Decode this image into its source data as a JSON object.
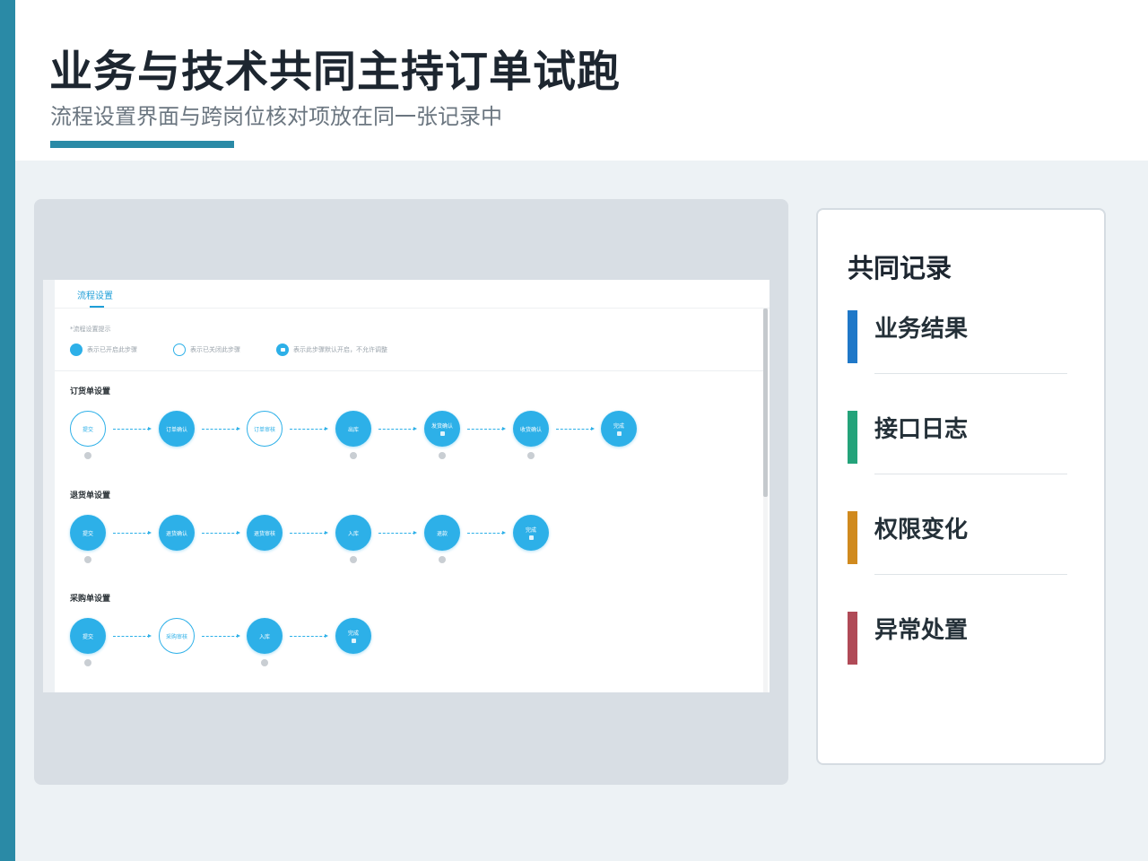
{
  "header": {
    "title": "业务与技术共同主持订单试跑",
    "subtitle": "流程设置界面与跨岗位核对项放在同一张记录中"
  },
  "screenshot": {
    "tab": "流程设置",
    "hint_title": "*流程设置提示",
    "legend": [
      "表示已开启此步骤",
      "表示已关闭此步骤",
      "表示此步骤默认开启，不允许调整"
    ],
    "sections": [
      {
        "title": "订货单设置",
        "steps": [
          {
            "label": "提交",
            "state": "off",
            "lock": false,
            "q": true
          },
          {
            "label": "订单确认",
            "state": "on",
            "lock": false,
            "q": false
          },
          {
            "label": "订单审核",
            "state": "off",
            "lock": false,
            "q": false
          },
          {
            "label": "出库",
            "state": "on",
            "lock": false,
            "q": true
          },
          {
            "label": "发货确认",
            "state": "on",
            "lock": true,
            "q": true
          },
          {
            "label": "收货确认",
            "state": "on",
            "lock": false,
            "q": true
          },
          {
            "label": "完成",
            "state": "on",
            "lock": true,
            "q": false
          }
        ]
      },
      {
        "title": "退货单设置",
        "steps": [
          {
            "label": "提交",
            "state": "on",
            "lock": false,
            "q": true
          },
          {
            "label": "退货确认",
            "state": "on",
            "lock": false,
            "q": false
          },
          {
            "label": "退货审核",
            "state": "on",
            "lock": false,
            "q": false
          },
          {
            "label": "入库",
            "state": "on",
            "lock": false,
            "q": true
          },
          {
            "label": "退款",
            "state": "on",
            "lock": false,
            "q": true
          },
          {
            "label": "完成",
            "state": "on",
            "lock": true,
            "q": false
          }
        ]
      },
      {
        "title": "采购单设置",
        "steps": [
          {
            "label": "提交",
            "state": "on",
            "lock": false,
            "q": true
          },
          {
            "label": "采购审核",
            "state": "off",
            "lock": false,
            "q": false
          },
          {
            "label": "入库",
            "state": "on",
            "lock": false,
            "q": true
          },
          {
            "label": "完成",
            "state": "on",
            "lock": true,
            "q": false
          }
        ]
      }
    ]
  },
  "card": {
    "title": "共同记录",
    "items": [
      {
        "label": "业务结果",
        "color": "#1f78c8"
      },
      {
        "label": "接口日志",
        "color": "#24a37a"
      },
      {
        "label": "权限变化",
        "color": "#d08a1e"
      },
      {
        "label": "异常处置",
        "color": "#b04a57"
      }
    ]
  }
}
